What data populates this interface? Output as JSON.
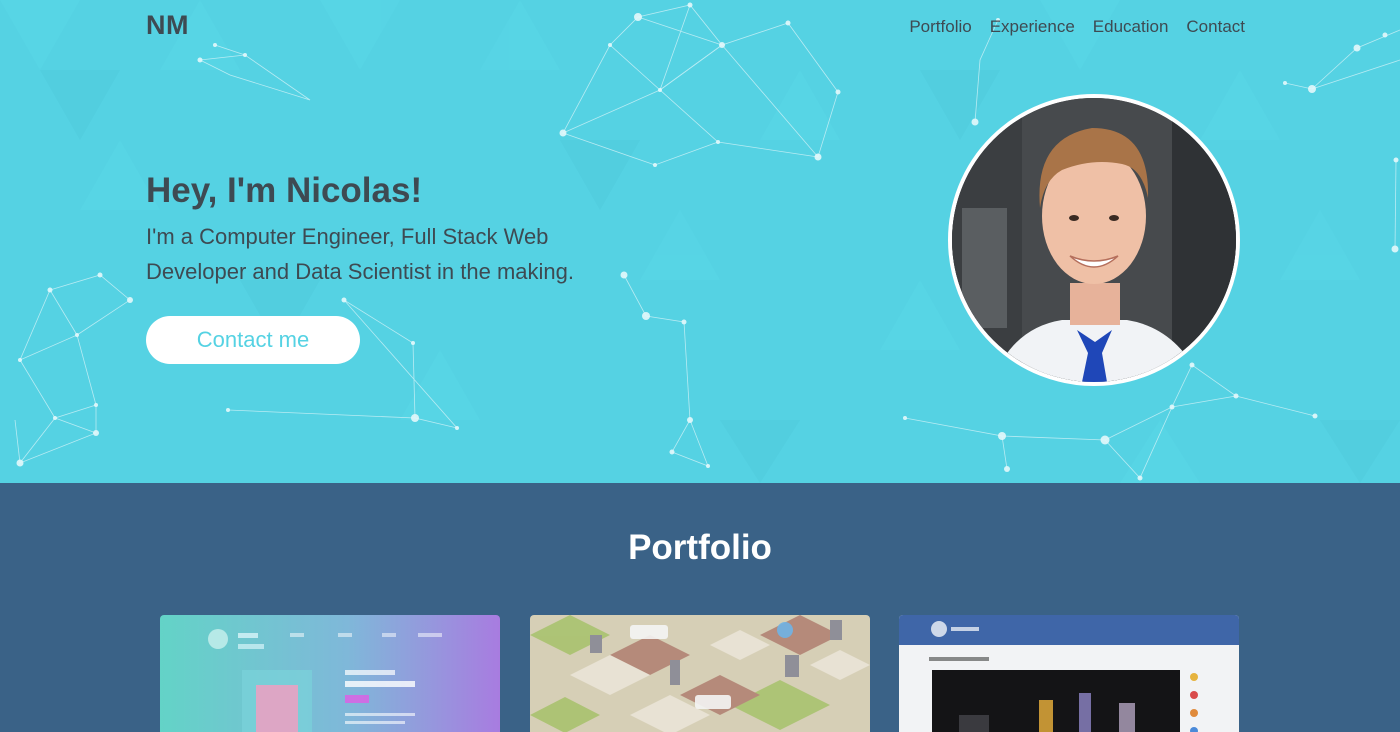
{
  "header": {
    "logo": "NM",
    "nav": [
      "Portfolio",
      "Experience",
      "Education",
      "Contact"
    ]
  },
  "hero": {
    "title": "Hey, I'm Nicolas!",
    "subtitle": "I'm a Computer Engineer, Full Stack Web Developer and Data Scientist in the making.",
    "cta": "Contact me"
  },
  "portfolio": {
    "title": "Portfolio",
    "cards": [
      "project-thumbnail-1",
      "project-thumbnail-2",
      "project-thumbnail-3"
    ]
  },
  "colors": {
    "hero_bg": "#55d2e3",
    "text_dark": "#3e4a52",
    "portfolio_bg": "#3a6287",
    "accent": "#55d2e3",
    "white": "#ffffff"
  }
}
